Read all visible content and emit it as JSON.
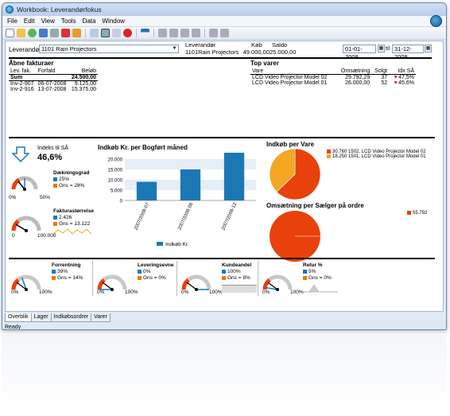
{
  "window": {
    "title": "Workbook: Leverandørfokus",
    "status": "Ready"
  },
  "menu": [
    "File",
    "Edit",
    "View",
    "Tools",
    "Data",
    "Window"
  ],
  "colors": {
    "blue": "#1b78b5",
    "orange": "#f5a623",
    "red": "#e8410b",
    "lightblue": "#e6eef8"
  },
  "filters": {
    "leverandor_label": "Leverandør",
    "leverandor_value": "1101 Rain Projectors",
    "info_label": "Leverandør",
    "info_value": "1101Rain Projectors",
    "kob_label": "Køb",
    "kob_value": "49.000,00",
    "saldo_label": "Saldo",
    "saldo_value": "25.000,00",
    "date_from": "01-01-2008",
    "date_to": "31-12-2008",
    "date_sep": "til"
  },
  "open_invoices": {
    "title": "Åbne fakturaer",
    "headers": [
      "Lev. fak.",
      "Forfald",
      "Beløb"
    ],
    "sum_label": "Sum",
    "sum_value": "24.500,00",
    "rows": [
      [
        "Inv-2-907",
        "06-07-2008",
        "9.125,00"
      ],
      [
        "Inv-2-916",
        "13-07-2008",
        "15.375,00"
      ]
    ]
  },
  "top_items": {
    "title": "Top varer",
    "headers": [
      "Vare",
      "Omsætning",
      "Solgt",
      "Idx SÅ"
    ],
    "rows": [
      [
        "LCD Video Projector Model 02",
        "29.792,29",
        "37",
        "47,5%"
      ],
      [
        "LCD Video Projector Model 01",
        "26.000,00",
        "52",
        "45,6%"
      ]
    ]
  },
  "kpi_main": {
    "index_label": "Indeks til SÅ",
    "index_value": "46,6%",
    "daekning_label": "Dækningsgrad",
    "daekning_value": "25%",
    "daekning_gns": "Gns = 28%",
    "daekning_min": "0%",
    "daekning_max": "50%",
    "faktura_label": "Fakturastørrelse",
    "faktura_value": "2.426",
    "faktura_gns": "Gns = 13.122",
    "faktura_min": "0",
    "faktura_max": "100.000"
  },
  "chart_data": [
    {
      "type": "bar",
      "title": "Indkøb Kr. per Bogført måned",
      "categories": [
        "2007/2008-07",
        "2007/2008-08",
        "2007/2008-12"
      ],
      "series": [
        {
          "name": "Indkøb Kr.",
          "values": [
            9000,
            15000,
            24500
          ]
        }
      ],
      "ylim": [
        0,
        20000
      ],
      "yticks": [
        "20.000",
        "15.000",
        "10.000",
        "5.000",
        "0"
      ],
      "legend": "bottom"
    },
    {
      "type": "pie",
      "title": "Indkøb per Vare",
      "slices": [
        {
          "label": "1502, LCD Video Projector Model 02",
          "value": 30760,
          "value_label": "30.760"
        },
        {
          "label": "1501, LCD Video Projector Model 01",
          "value": 18250,
          "value_label": "18.250"
        }
      ],
      "legend": "right"
    },
    {
      "type": "pie",
      "title": "Omsætning per Sælger på ordre",
      "slices": [
        {
          "label": "",
          "value": 55792,
          "value_label": "55.792"
        }
      ],
      "legend": "right"
    }
  ],
  "kpi_bottom": [
    {
      "label": "Forrentning",
      "value": "39%",
      "gns": "Gns = 14%",
      "min": "0%",
      "max": "100%"
    },
    {
      "label": "Leveringsevne",
      "value": "0%",
      "gns": "Gns = 0%",
      "min": "0%",
      "max": "100%"
    },
    {
      "label": "Kundeandel",
      "value": "100%",
      "gns": "Gns = 8%",
      "min": "0%",
      "max": "100%"
    },
    {
      "label": "Retur %",
      "value": "5%",
      "gns": "Gns = 0%",
      "min": "0%",
      "max": "100%"
    }
  ],
  "tabs": [
    "Overblik",
    "Lager",
    "Indkøbsordrer",
    "Varer"
  ]
}
